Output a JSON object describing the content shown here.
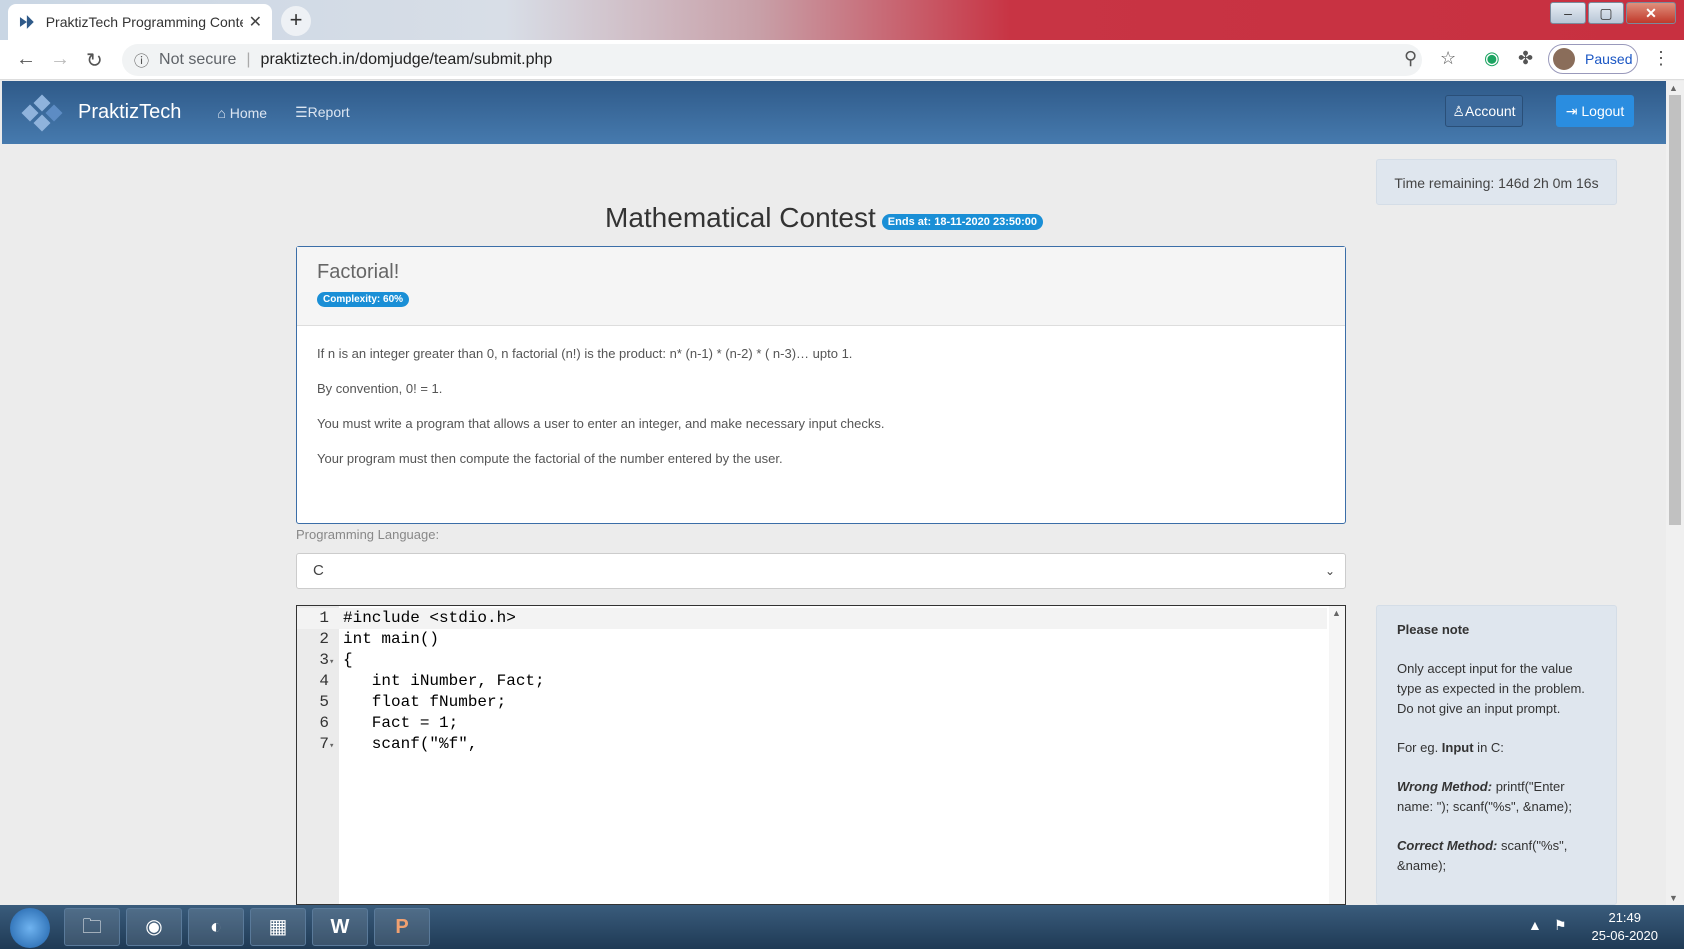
{
  "browser": {
    "tab_title": "PraktizTech Programming Contest",
    "tab_close": "✕",
    "new_tab": "+",
    "security": "Not secure",
    "url": "praktiztech.in/domjudge/team/submit.php",
    "profile_status": "Paused"
  },
  "nav": {
    "brand": "PraktizTech",
    "home": "Home",
    "report": "Report",
    "account": "Account",
    "logout": "Logout"
  },
  "contest": {
    "time_remaining": "Time remaining: 146d 2h 0m 16s",
    "title": "Mathematical Contest",
    "ends_badge": "Ends at: 18-11-2020 23:50:00"
  },
  "problem": {
    "title": "Factorial!",
    "complexity": "Complexity: 60%",
    "paragraphs": [
      "If n is an integer greater than 0, n factorial (n!) is the product: n* (n-1) * (n-2) * ( n-3)… upto 1.",
      "By convention, 0! = 1.",
      "You must write a program that allows a user to enter an integer, and make necessary input checks.",
      "Your program must then compute the factorial of the number entered by the user."
    ]
  },
  "language": {
    "label": "Programming Language:",
    "selected": "C"
  },
  "editor": {
    "lines": [
      {
        "n": "1",
        "fold": "",
        "code": "#include <stdio.h>"
      },
      {
        "n": "2",
        "fold": "",
        "code": "int main()"
      },
      {
        "n": "3",
        "fold": "▾",
        "code": "{"
      },
      {
        "n": "4",
        "fold": "",
        "code": "   int iNumber, Fact;"
      },
      {
        "n": "5",
        "fold": "",
        "code": "   float fNumber;"
      },
      {
        "n": "6",
        "fold": "",
        "code": "   Fact = 1;"
      },
      {
        "n": "7",
        "fold": "▾",
        "code": "   scanf(\"%f\","
      }
    ]
  },
  "note": {
    "heading": "Please note",
    "p1": "Only accept input for the value type as expected in the problem. Do not give an input prompt.",
    "p2_prefix": "For eg. ",
    "p2_bold": "Input",
    "p2_suffix": " in C:",
    "wrong_label": "Wrong Method:",
    "wrong_text": " printf(\"Enter name: \"); scanf(\"%s\", &name);",
    "correct_label": "Correct Method:",
    "correct_text": " scanf(\"%s\", &name);"
  },
  "taskbar": {
    "time": "21:49",
    "date": "25-06-2020"
  },
  "colors": {
    "navbar": "#3a6a9c",
    "badge": "#1a8fd6",
    "logout": "#2a8de0"
  }
}
